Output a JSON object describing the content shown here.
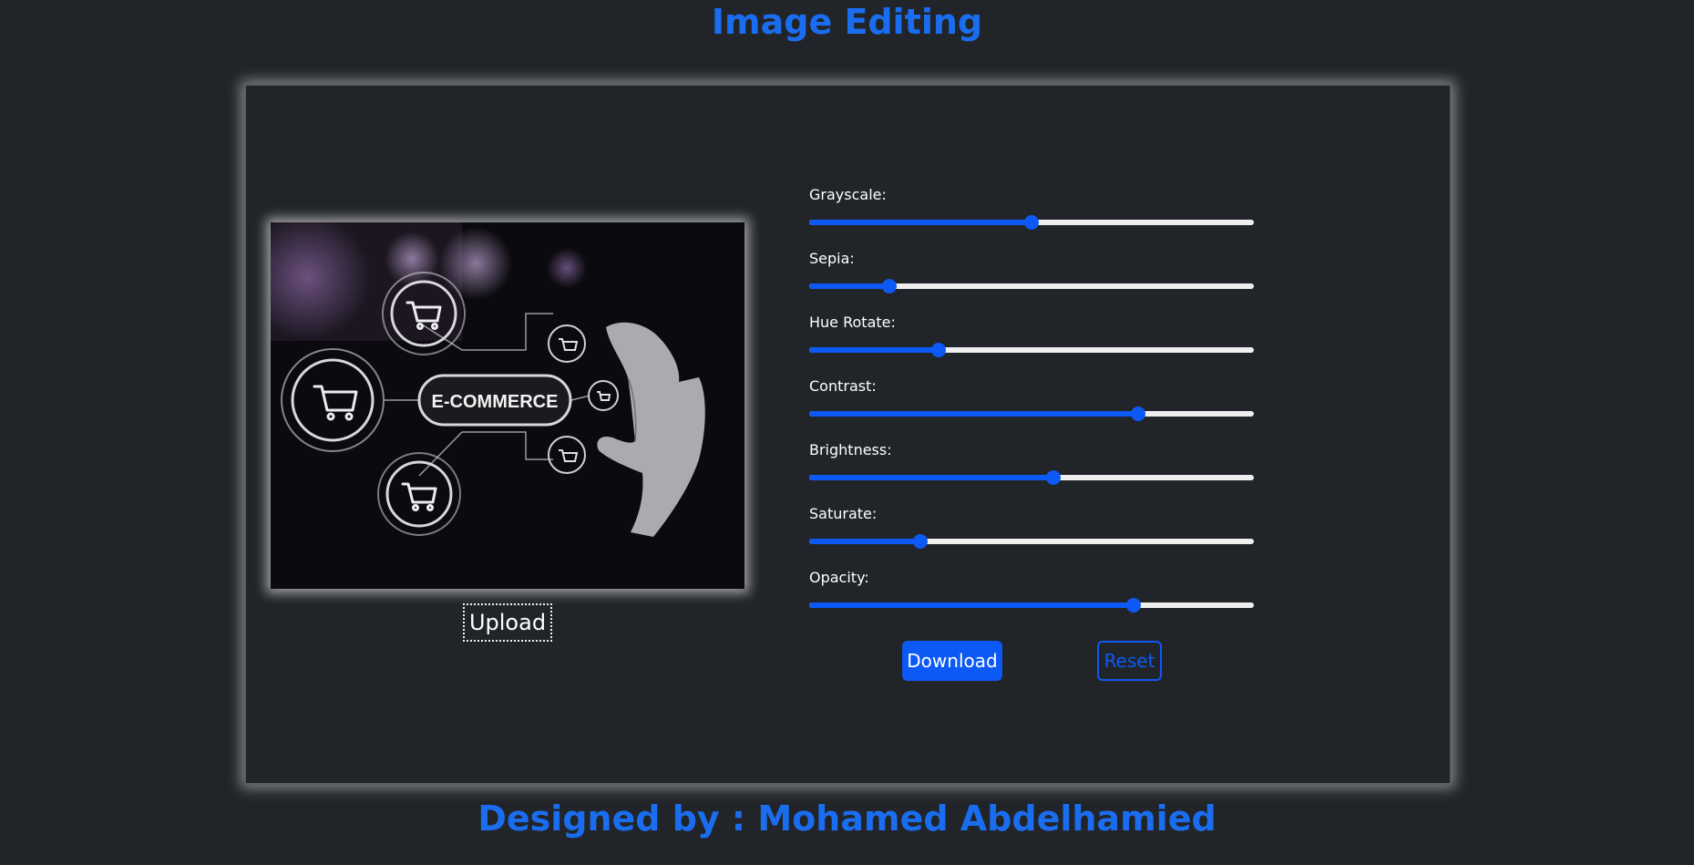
{
  "header": {
    "title": "Image Editing"
  },
  "preview": {
    "image_text": "E-COMMERCE"
  },
  "upload": {
    "label": "Upload"
  },
  "filters": [
    {
      "label": "Grayscale:",
      "value": 0.5
    },
    {
      "label": "Sepia:",
      "value": 0.18
    },
    {
      "label": "Hue Rotate:",
      "value": 0.29
    },
    {
      "label": "Contrast:",
      "value": 0.74
    },
    {
      "label": "Brightness:",
      "value": 0.55
    },
    {
      "label": "Saturate:",
      "value": 0.25
    },
    {
      "label": "Opacity:",
      "value": 0.73
    }
  ],
  "actions": {
    "download_label": "Download",
    "reset_label": "Reset"
  },
  "footer": {
    "text": "Designed by : Mohamed Abdelhamied"
  },
  "colors": {
    "background": "#212529",
    "accent": "#0d59f5",
    "title": "#1b6df0",
    "track": "#efefef"
  }
}
